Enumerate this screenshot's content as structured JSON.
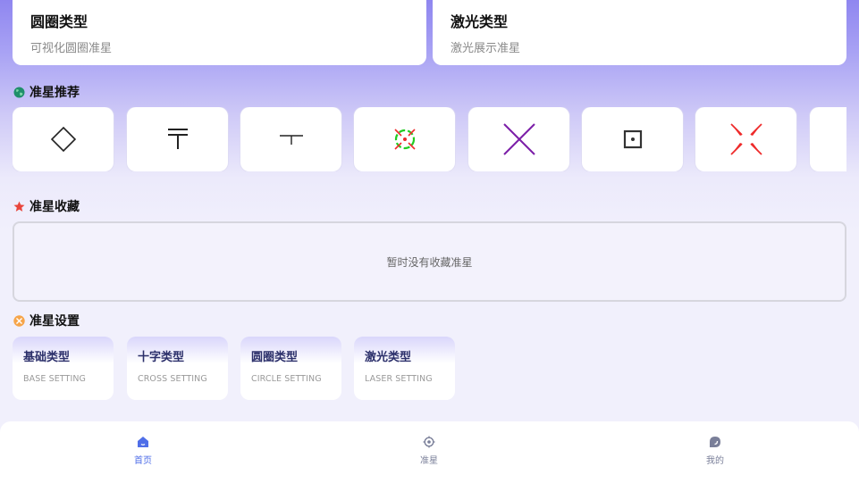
{
  "top_cards": [
    {
      "title": "圆圈类型",
      "subtitle": "可视化圆圈准星"
    },
    {
      "title": "激光类型",
      "subtitle": "激光展示准星"
    }
  ],
  "sections": {
    "recommend": {
      "title": "准星推荐",
      "icon": "globe-icon"
    },
    "favorites": {
      "title": "准星收藏",
      "icon": "star-icon",
      "empty_text": "暂时没有收藏准星"
    },
    "settings": {
      "title": "准星设置",
      "icon": "settings-badge-icon"
    }
  },
  "recommend_items": [
    {
      "icon": "diamond-crosshair-icon"
    },
    {
      "icon": "double-t-crosshair-icon"
    },
    {
      "icon": "t-crosshair-icon"
    },
    {
      "icon": "circle-x-crosshair-icon"
    },
    {
      "icon": "purple-x-crosshair-icon"
    },
    {
      "icon": "dot-square-crosshair-icon"
    },
    {
      "icon": "red-split-x-crosshair-icon"
    }
  ],
  "setting_items": [
    {
      "title": "基础类型",
      "subtitle": "BASE SETTING"
    },
    {
      "title": "十字类型",
      "subtitle": "CROSS SETTING"
    },
    {
      "title": "圆圈类型",
      "subtitle": "CIRCLE SETTING"
    },
    {
      "title": "激光类型",
      "subtitle": "LASER SETTING"
    }
  ],
  "tabs": [
    {
      "label": "首页",
      "icon": "home-icon",
      "active": true
    },
    {
      "label": "准星",
      "icon": "crosshair-icon",
      "active": false
    },
    {
      "label": "我的",
      "icon": "profile-icon",
      "active": false
    }
  ],
  "colors": {
    "accent": "#4f6ee8",
    "tab_inactive": "#7a7f99",
    "crosshair_red": "#ee2a2a",
    "crosshair_purple": "#7c1fa8"
  }
}
